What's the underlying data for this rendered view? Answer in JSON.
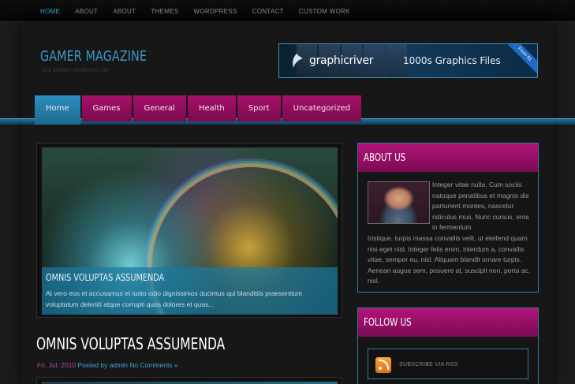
{
  "topnav": {
    "items": [
      {
        "label": "HOME",
        "active": true
      },
      {
        "label": "ABOUT"
      },
      {
        "label": "ABOUT"
      },
      {
        "label": "THEMES"
      },
      {
        "label": "WORDPRESS"
      },
      {
        "label": "CONTACT"
      },
      {
        "label": "CUSTOM WORK"
      }
    ]
  },
  "site": {
    "title": "GAMER MAGAZINE",
    "tagline": "Just another wordpress site"
  },
  "banner": {
    "brand": "graphicriver",
    "tagline": "1000s Graphics Files",
    "corner": "From $1"
  },
  "mainnav": {
    "items": [
      {
        "label": "Home",
        "active": true
      },
      {
        "label": "Games"
      },
      {
        "label": "General"
      },
      {
        "label": "Health"
      },
      {
        "label": "Sport"
      },
      {
        "label": "Uncategorized"
      }
    ]
  },
  "featured": {
    "title": "OMNIS VOLUPTAS ASSUMENDA",
    "excerpt": "At vero eos et accusamus et iusto odio dignissimos ducimus qui blanditiis praesentium voluptatum deleniti atque corrupti quos dolores et quas..."
  },
  "post": {
    "title": "OMNIS VOLUPTAS ASSUMENDA",
    "date": "Fri, Jul, 2010",
    "posted_by_label": "Posted by",
    "author": "admin",
    "comments": "No Comments »"
  },
  "sidebar": {
    "about": {
      "heading": "ABOUT US",
      "text_beside_photo": "Integer vitae nulla. Cum sociis natoque penatibus et magnis dis parturient montes, nascetur ridiculus mus. Nunc cursus, eros in fermentum",
      "text_below_photo": "tristique, turpis massa convallis velit, ut eleifend quam nisi eget nisl. Integer felis enim, interdum a, convallis vitae, semper eu, nisl. Aliquam blandit ornare turpis. Aenean augue sem, posuere at, suscipit non, porta ac, nisl."
    },
    "follow": {
      "heading": "FOLLOW US",
      "rss_label": "SUBSCRIBE VIA RSS"
    }
  },
  "colors": {
    "accent_blue": "#3ea5d6",
    "accent_magenta": "#a6126a"
  }
}
